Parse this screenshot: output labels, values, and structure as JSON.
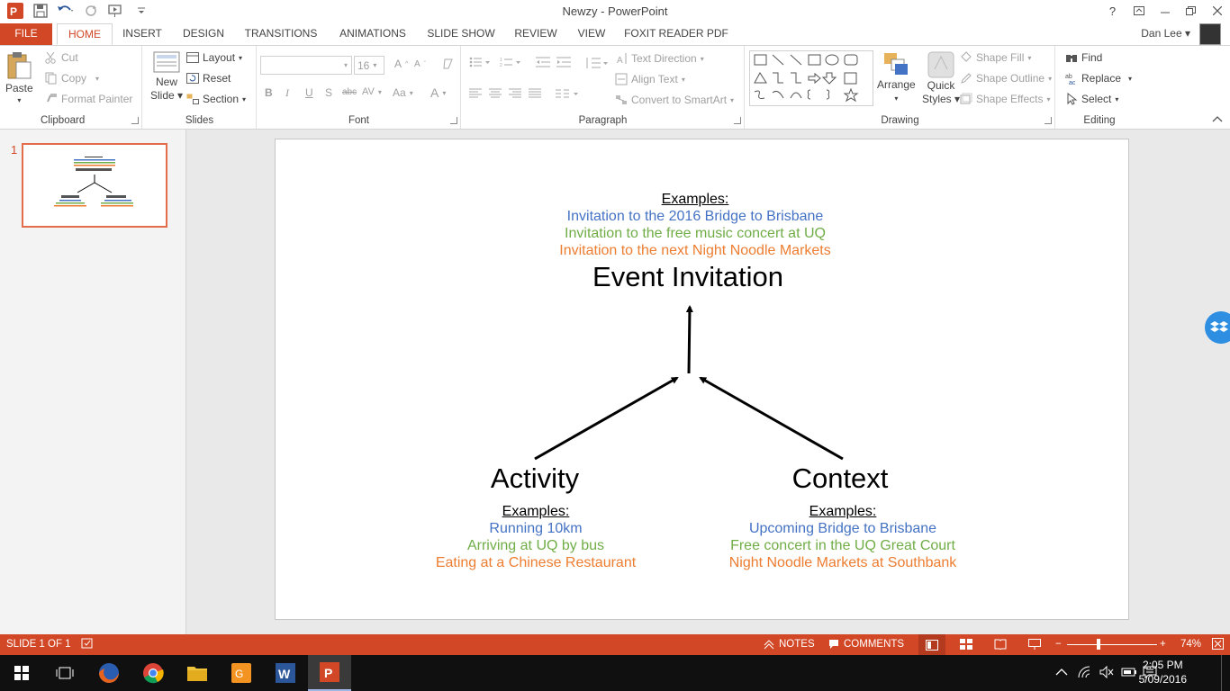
{
  "window": {
    "title": "Newzy - PowerPoint",
    "help": "?",
    "user": "Dan Lee"
  },
  "tabs": [
    {
      "label": "FILE"
    },
    {
      "label": "HOME"
    },
    {
      "label": "INSERT"
    },
    {
      "label": "DESIGN"
    },
    {
      "label": "TRANSITIONS"
    },
    {
      "label": "ANIMATIONS"
    },
    {
      "label": "SLIDE SHOW"
    },
    {
      "label": "REVIEW"
    },
    {
      "label": "VIEW"
    },
    {
      "label": "FOXIT READER PDF"
    }
  ],
  "ribbon": {
    "clipboard": {
      "label": "Clipboard",
      "paste": "Paste",
      "cut": "Cut",
      "copy": "Copy",
      "format_painter": "Format Painter"
    },
    "slides": {
      "label": "Slides",
      "new_slide_line1": "New",
      "new_slide_line2": "Slide",
      "layout": "Layout",
      "reset": "Reset",
      "section": "Section"
    },
    "font": {
      "label": "Font",
      "font_name": "",
      "font_size": "16"
    },
    "paragraph": {
      "label": "Paragraph",
      "text_direction": "Text Direction",
      "align_text": "Align Text",
      "convert_smartart": "Convert to SmartArt"
    },
    "drawing": {
      "label": "Drawing",
      "arrange": "Arrange",
      "quick_styles_line1": "Quick",
      "quick_styles_line2": "Styles",
      "shape_fill": "Shape Fill",
      "shape_outline": "Shape Outline",
      "shape_effects": "Shape Effects"
    },
    "editing": {
      "label": "Editing",
      "find": "Find",
      "replace": "Replace",
      "select": "Select"
    }
  },
  "thumbnails": [
    {
      "number": "1"
    }
  ],
  "slide": {
    "top_examples": {
      "heading": "Examples:",
      "items": [
        "Invitation to the 2016 Bridge to Brisbane",
        "Invitation to the free music concert at UQ",
        "Invitation to the next Night Noodle Markets"
      ]
    },
    "main_title": "Event Invitation",
    "activity": {
      "title": "Activity",
      "heading": "Examples:",
      "items": [
        "Running 10km",
        "Arriving at UQ by bus",
        "Eating at a Chinese Restaurant"
      ]
    },
    "context": {
      "title": "Context",
      "heading": "Examples:",
      "items": [
        "Upcoming Bridge to Brisbane",
        "Free concert in the UQ Great Court",
        "Night Noodle Markets at Southbank"
      ]
    }
  },
  "status": {
    "slide_count": "SLIDE 1 OF 1",
    "notes": "NOTES",
    "comments": "COMMENTS",
    "zoom": "74%"
  },
  "taskbar": {
    "time": "2:05 PM",
    "date": "5/09/2016"
  },
  "colors": {
    "accent": "#d24726",
    "blue_text": "#4472c4",
    "green_text": "#70ad47",
    "orange_text": "#ed7d31"
  }
}
